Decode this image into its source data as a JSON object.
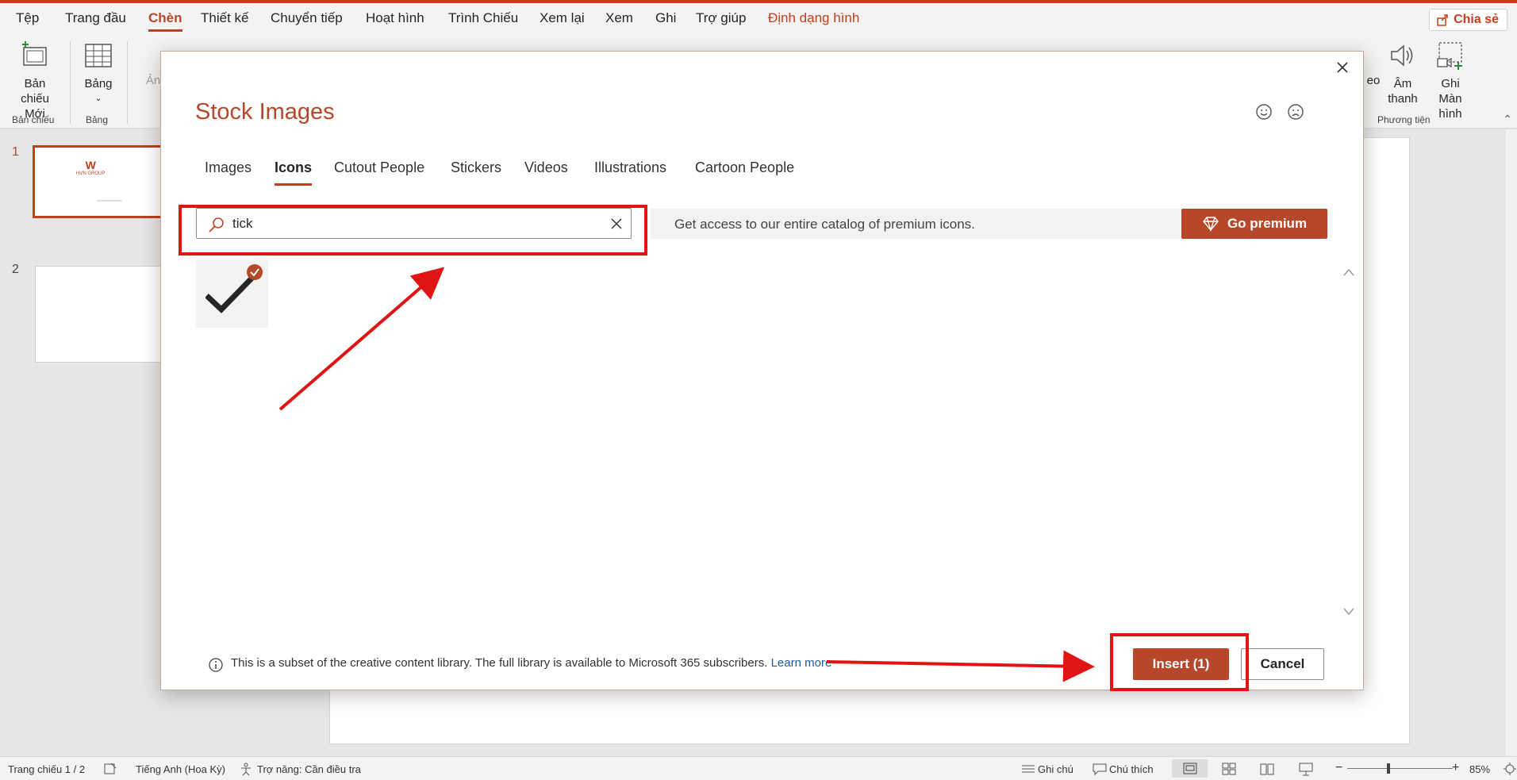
{
  "menu": {
    "tabs": [
      "Tệp",
      "Trang đầu",
      "Chèn",
      "Thiết kế",
      "Chuyển tiếp",
      "Hoạt hình",
      "Trình Chiếu",
      "Xem lại",
      "Xem",
      "Ghi",
      "Trợ giúp",
      "Định dạng hình"
    ],
    "active_tab": "Chèn",
    "share_label": "Chia sẻ"
  },
  "ribbon": {
    "new_slide_label": "Bản chiếu Mới",
    "table_label": "Bảng",
    "image_label_partial": "Ản",
    "video_label_partial": "eo",
    "audio_label": "Âm thanh",
    "screen_record_label": "Ghi Màn hình",
    "groups": {
      "slides": "Bản chiếu",
      "tables": "Bảng",
      "media": "Phương tiện"
    }
  },
  "thumbnails": [
    {
      "number": "1",
      "logo_text": "HVN GROUP"
    },
    {
      "number": "2"
    }
  ],
  "dialog": {
    "title": "Stock Images",
    "tabs": [
      "Images",
      "Icons",
      "Cutout People",
      "Stickers",
      "Videos",
      "Illustrations",
      "Cartoon People"
    ],
    "active_tab": "Icons",
    "search_value": "tick",
    "premium_text": "Get access to our entire catalog of premium icons.",
    "premium_button": "Go premium",
    "results": [
      {
        "icon": "checkmark-icon",
        "selected": true
      }
    ],
    "footer_text": "This is a subset of the creative content library. The full library is available to Microsoft 365 subscribers.",
    "footer_link": "Learn more",
    "insert_button": "Insert (1)",
    "cancel_button": "Cancel"
  },
  "statusbar": {
    "slide_counter": "Trang chiếu 1 / 2",
    "language": "Tiếng Anh (Hoa Kỳ)",
    "accessibility": "Trợ năng: Cần điều tra",
    "notes": "Ghi chú",
    "comments": "Chú thích",
    "zoom": "85%"
  },
  "colors": {
    "accent": "#c43e1c",
    "brand_button": "#b7472a",
    "annotation": "#e01414"
  }
}
